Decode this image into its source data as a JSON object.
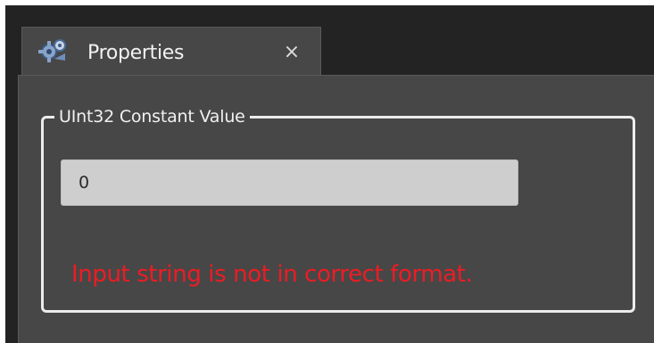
{
  "tab": {
    "title": "Properties",
    "icon": "properties-gear-icon",
    "close_glyph": "×"
  },
  "group": {
    "legend": "UInt32 Constant Value"
  },
  "input": {
    "value": "0"
  },
  "validation": {
    "error": "Input string is not in correct format.",
    "color": "#ec1c24"
  },
  "theme": {
    "background": "#232323",
    "panel": "#474747",
    "border": "#ececec"
  }
}
